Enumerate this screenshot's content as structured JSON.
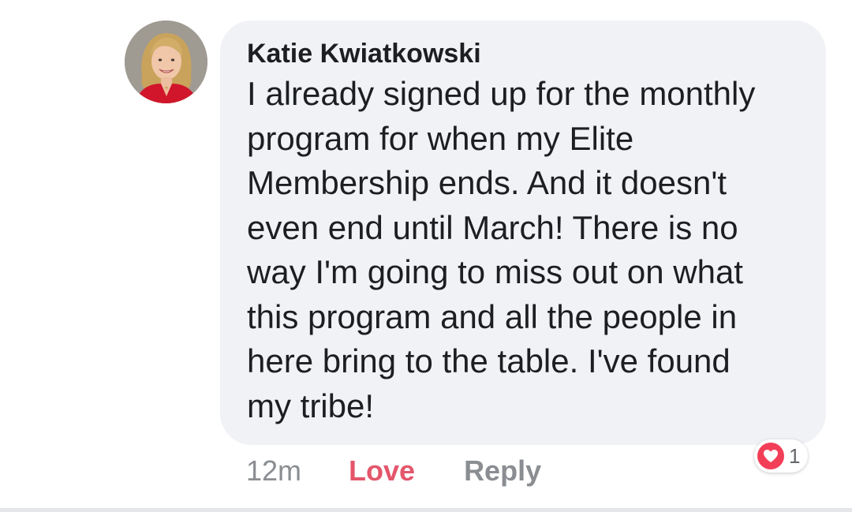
{
  "comment": {
    "author": "Katie Kwiatkowski",
    "text": "I already signed up for the monthly\nprogram for when my Elite\nMembership ends.  And it doesn't\neven end until March!  There is no\nway I'm going to miss out on what\nthis program and all the people in\nhere bring to the table.  I've found\nmy tribe!",
    "avatar_icon": "profile-photo"
  },
  "actions": {
    "time": "12m",
    "love_label": "Love",
    "reply_label": "Reply"
  },
  "reactions": {
    "icon": "heart-icon",
    "count": "1"
  },
  "colors": {
    "love": "#e4566b",
    "heart_badge": "#f33e58",
    "bubble": "#f0f2f5",
    "muted": "#8a8d91"
  }
}
